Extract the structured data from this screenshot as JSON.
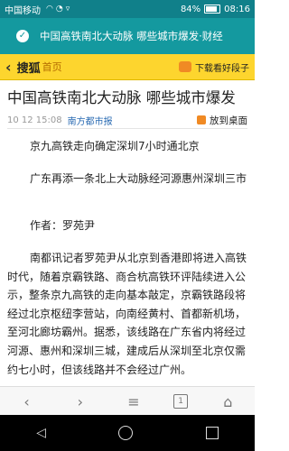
{
  "status_bar": {
    "carrier": "中国移动",
    "icons": [
      "wifi-icon",
      "alarm-icon",
      "location-icon"
    ],
    "battery": "84%",
    "time": "08:16"
  },
  "notification": {
    "text": "中国高铁南北大动脉 哪些城市爆发·财经"
  },
  "top_bar": {
    "logo": "搜狐",
    "home": "首页",
    "download": "下载看好段子"
  },
  "article": {
    "title": "中国高铁南北大动脉 哪些城市爆发",
    "date": "10 12 15:08",
    "source": "南方都市报",
    "desktop": "放到桌面",
    "lead1": "京九高铁走向确定深圳7小时通北京",
    "lead2": "广东再添一条北上大动脉经河源惠州深圳三市",
    "author": "作者：罗苑尹",
    "body": "南都讯记者罗苑尹从北京到香港即将进入高铁时代，随着京霸铁路、商合杭高铁环评陆续进入公示，整条京九高铁的走向基本敲定，京霸铁路段将经过北京枢纽李营站，向南经黄村、首都新机场，至河北廊坊霸州。据悉，该线路在广东省内将经过河源、惠州和深圳三城，建成后从深圳至北京仅需约七小时，但该线路并不会经过广州。"
  },
  "toolbar": {
    "back": "‹",
    "forward": "›",
    "menu": "≡",
    "tabs": "1",
    "home": "⌂"
  },
  "navbar": {
    "back": "◁"
  }
}
